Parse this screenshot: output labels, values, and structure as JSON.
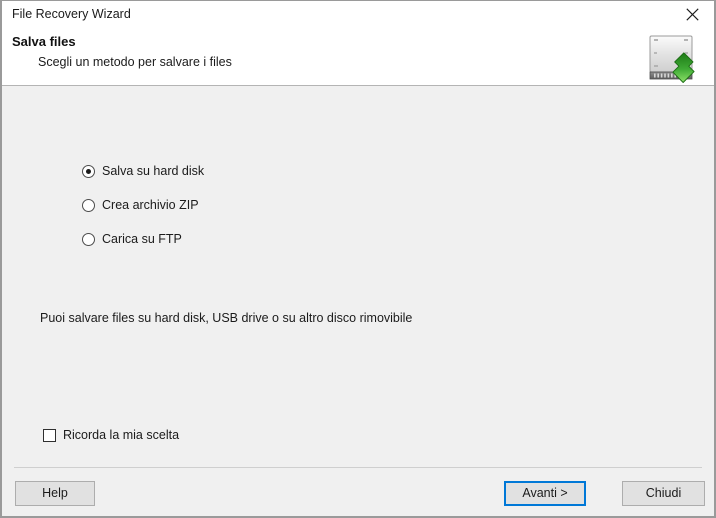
{
  "window": {
    "title": "File Recovery Wizard",
    "close_icon": "close-icon"
  },
  "header": {
    "title": "Salva files",
    "subtitle": "Scegli un metodo per salvare i files",
    "icon": "hard-disk-save-icon"
  },
  "main": {
    "options": [
      {
        "label": "Salva su hard disk",
        "selected": true
      },
      {
        "label": "Crea archivio ZIP",
        "selected": false
      },
      {
        "label": "Carica su FTP",
        "selected": false
      }
    ],
    "hint": "Puoi salvare files su hard disk, USB drive o su altro disco rimovibile",
    "remember": {
      "label": "Ricorda la mia scelta",
      "checked": false
    }
  },
  "footer": {
    "help_label": "Help",
    "next_label": "Avanti >",
    "close_label": "Chiudi"
  },
  "colors": {
    "accent": "#0078d7",
    "window_bg": "#f0f0f0",
    "header_bg": "#ffffff",
    "text": "#1b1b1b",
    "icon_green": "#3faa35"
  }
}
